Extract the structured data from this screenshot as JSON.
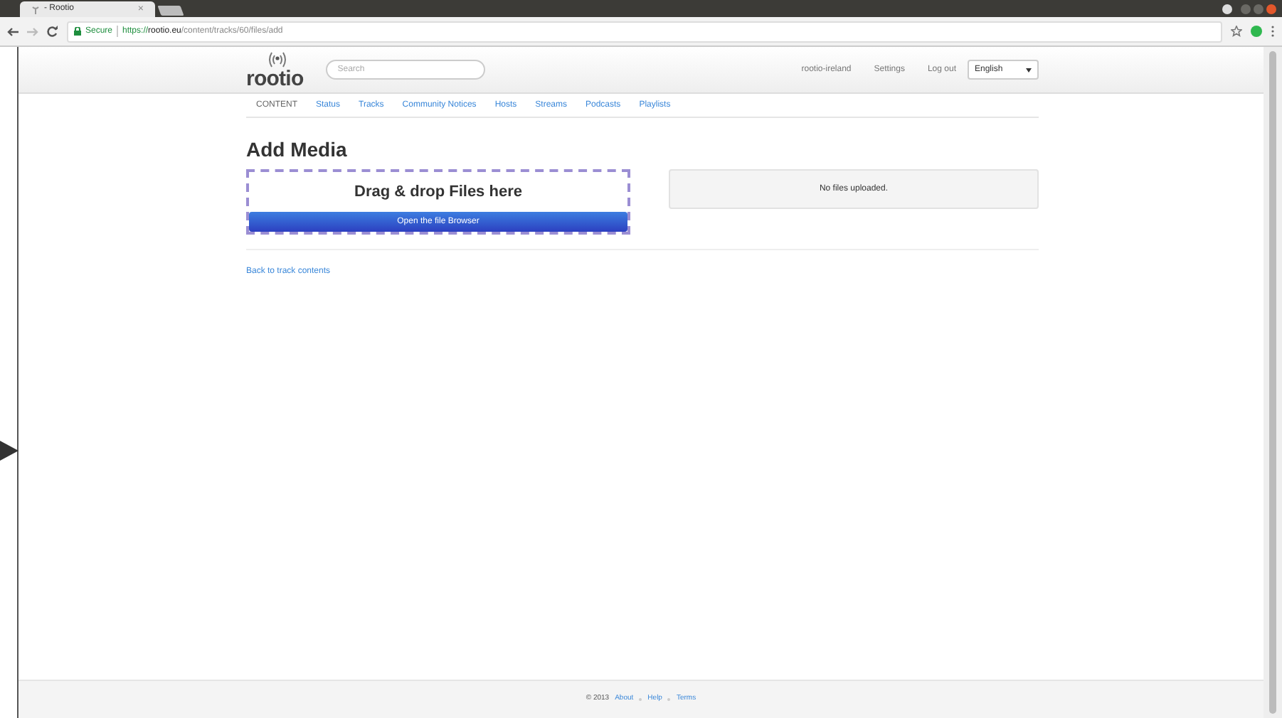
{
  "browser": {
    "tab_title": "- Rootio",
    "tab_close": "×",
    "url_secure": "Secure",
    "url_scheme": "https://",
    "url_host": "rootio.eu",
    "url_path": "/content/tracks/60/files/add"
  },
  "header": {
    "logo": "rootio",
    "search": {
      "placeholder": "Search"
    },
    "user": "rootio-ireland",
    "settings": "Settings",
    "logout": "Log out",
    "language": "English"
  },
  "nav": {
    "section": "CONTENT",
    "links": [
      "Status",
      "Tracks",
      "Community Notices",
      "Hosts",
      "Streams",
      "Podcasts",
      "Playlists"
    ]
  },
  "page": {
    "title": "Add Media",
    "dropzone": "Drag & drop Files here",
    "browse_button": "Open the file Browser",
    "uploads_empty": "No files uploaded.",
    "back_link": "Back to track contents"
  },
  "footer": {
    "copyright": "© 2013",
    "links": [
      "About",
      "Help",
      "Terms"
    ]
  }
}
